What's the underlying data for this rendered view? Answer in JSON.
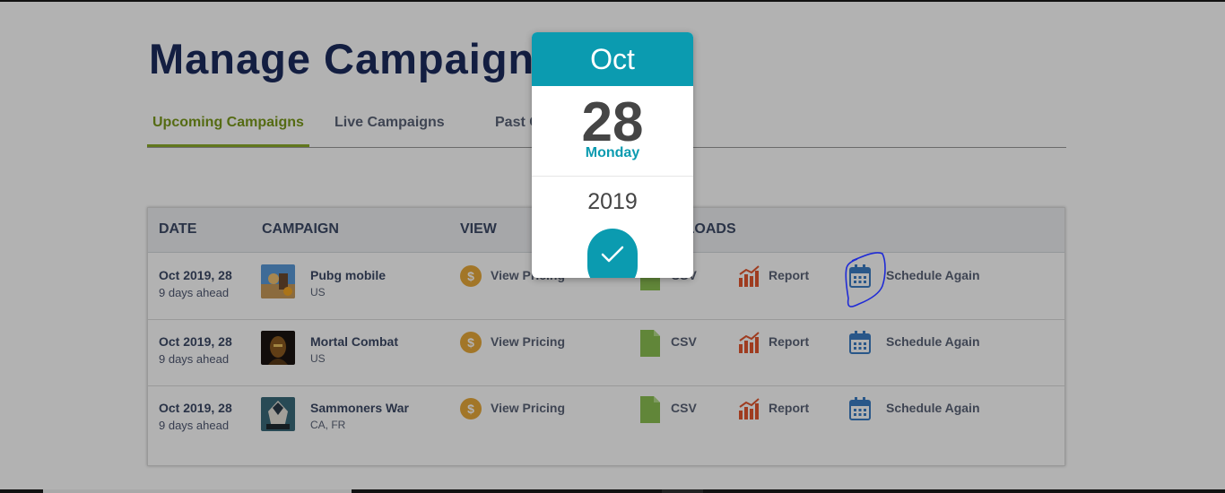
{
  "page": {
    "title": "Manage Campaigns"
  },
  "tabs": [
    {
      "label": "Upcoming Campaigns",
      "active": true
    },
    {
      "label": "Live Campaigns",
      "active": false
    },
    {
      "label": "Past Campaigns",
      "active": false
    }
  ],
  "table": {
    "headers": [
      "DATE",
      "CAMPAIGN",
      "VIEW",
      "DOWNLOADS"
    ],
    "rows": [
      {
        "date": "Oct 2019, 28",
        "ahead": "9 days ahead",
        "name": "Pubg mobile",
        "country": "US",
        "view": "View Pricing",
        "csv": "CSV",
        "report": "Report",
        "schedule": "Schedule Again",
        "thumb": "pubg-thumbnail"
      },
      {
        "date": "Oct 2019, 28",
        "ahead": "9 days ahead",
        "name": "Mortal Combat",
        "country": "US",
        "view": "View Pricing",
        "csv": "CSV",
        "report": "Report",
        "schedule": "Schedule Again",
        "thumb": "mortal-combat-thumbnail"
      },
      {
        "date": "Oct 2019, 28",
        "ahead": "9 days ahead",
        "name": "Sammoners War",
        "country": "CA, FR",
        "view": "View Pricing",
        "csv": "CSV",
        "report": "Report",
        "schedule": "Schedule Again",
        "thumb": "summoners-war-thumbnail"
      }
    ]
  },
  "date_picker": {
    "month": "Oct",
    "day": "28",
    "weekday": "Monday",
    "year": "2019",
    "confirm_icon": "checkmark-icon"
  },
  "icons": {
    "coin": "dollar-coin-icon",
    "csv": "document-icon",
    "report": "bar-chart-icon",
    "schedule": "calendar-icon"
  },
  "colors": {
    "accent_teal": "#0b9bb0",
    "active_tab": "#7a9a1c",
    "title": "#1c2b5e",
    "coin": "#e8a93a",
    "csv_icon": "#8cc152",
    "report_icon": "#e4572e",
    "calendar_icon": "#3b7dc4",
    "annotation": "#1f2bd6"
  },
  "coin_symbol": "$"
}
